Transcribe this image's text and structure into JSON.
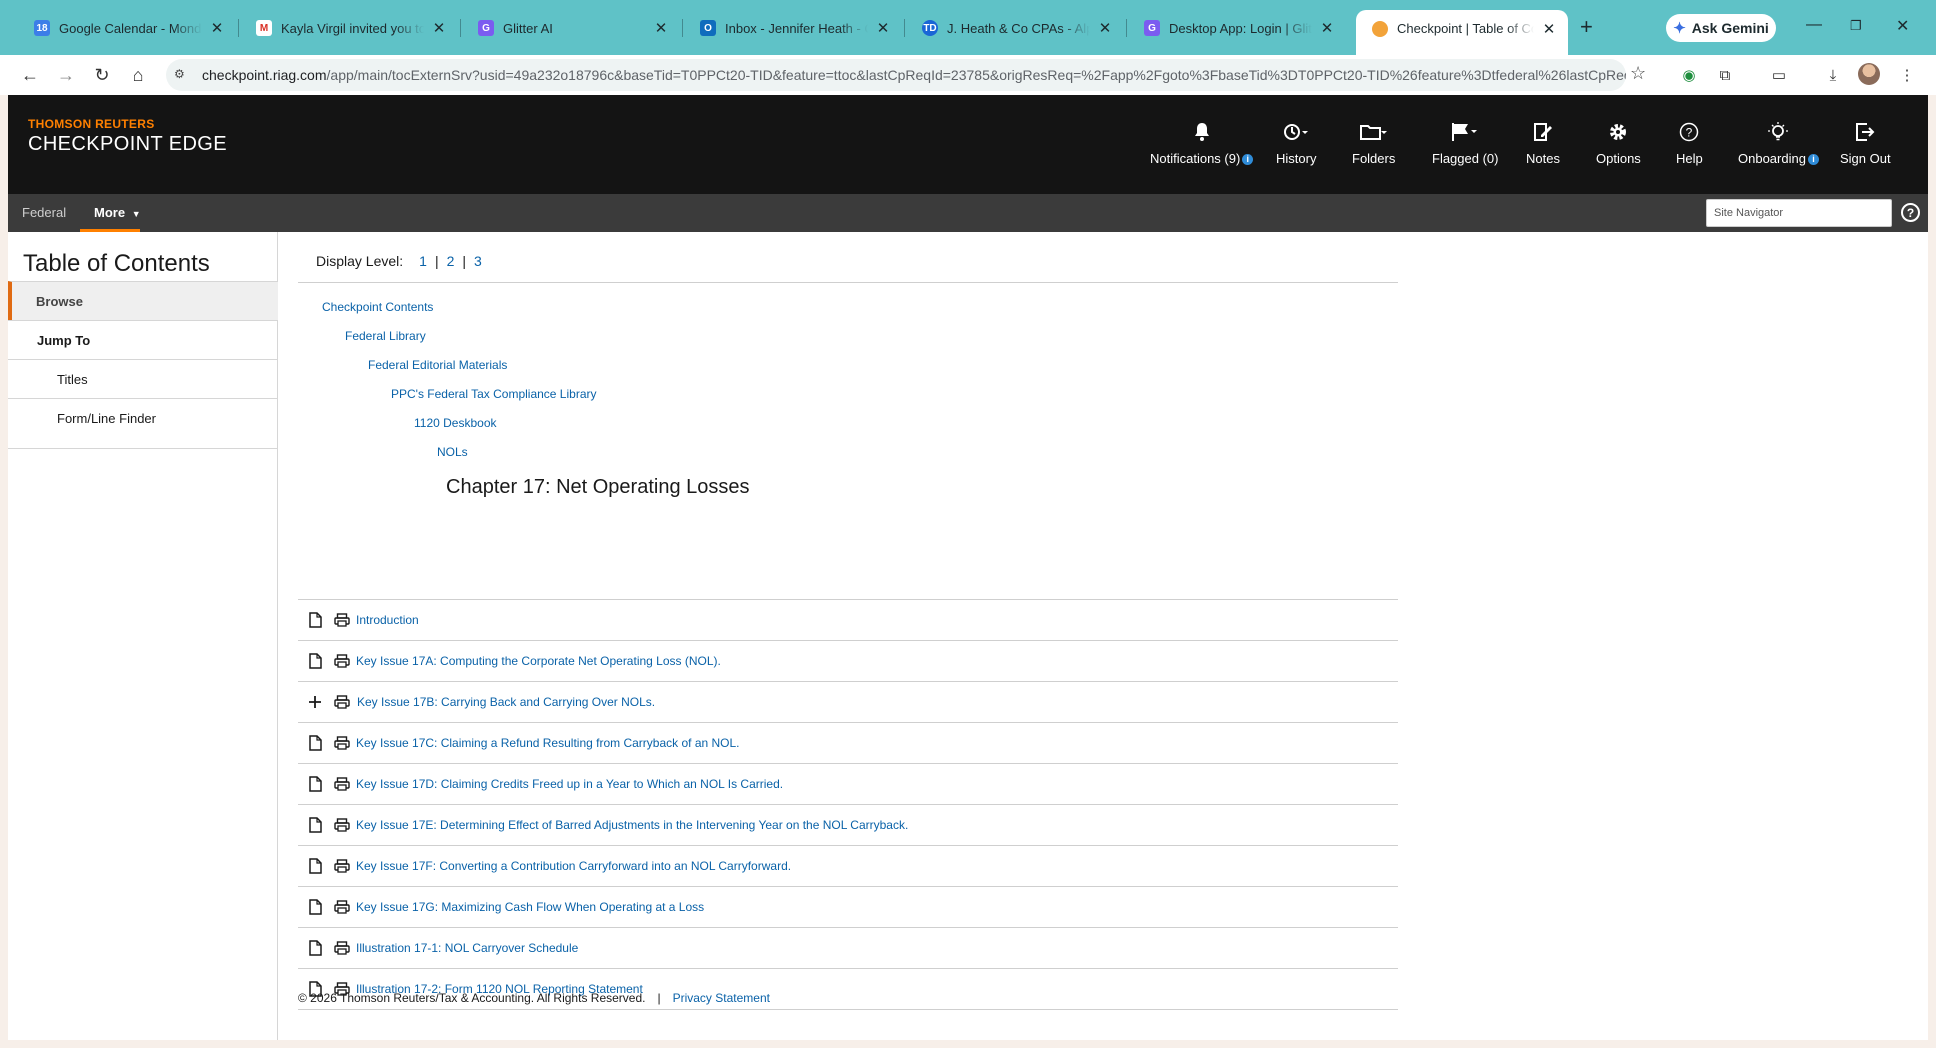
{
  "browser": {
    "tabs": [
      {
        "title": "Google Calendar - Monday,",
        "icon": "calendar-icon",
        "color": "#3c7ee8"
      },
      {
        "title": "Kayla Virgil invited you to jo",
        "icon": "gmail-icon",
        "color": "#d93025"
      },
      {
        "title": "Glitter AI",
        "icon": "glitter-icon",
        "color": "#7b5cf0"
      },
      {
        "title": "Inbox - Jennifer Heath - Out",
        "icon": "outlook-icon",
        "color": "#0f6cbd"
      },
      {
        "title": "J. Heath & Co CPAs - Alperin",
        "icon": "teamdrive-icon",
        "color": "#1a66d6"
      },
      {
        "title": "Desktop App: Login | Glitter",
        "icon": "glitter-icon",
        "color": "#7b5cf0"
      },
      {
        "title": "Checkpoint | Table of Conter",
        "icon": "checkpoint-icon",
        "color": "#f2a33a"
      }
    ],
    "new_tab": "+",
    "ask_gemini": "Ask Gemini",
    "url_host": "checkpoint.riag.com",
    "url_rest": "/app/main/tocExternSrv?usid=49a232o18796c&baseTid=T0PPCt20-TID&feature=ttoc&lastCpReqId=23785&origResReq=%2Fapp%2Fgoto%3FbaseTid%3DT0PPCt20-TID%26feature%3Dtfederal%26lastCpReql..."
  },
  "header": {
    "brand_top": "THOMSON REUTERS",
    "brand_main": "CHECKPOINT EDGE",
    "nav": [
      {
        "label": "Notifications (9)",
        "icon": "bell-icon",
        "badge": "i"
      },
      {
        "label": "History",
        "icon": "history-icon"
      },
      {
        "label": "Folders",
        "icon": "folder-icon"
      },
      {
        "label": "Flagged (0)",
        "icon": "flag-icon"
      },
      {
        "label": "Notes",
        "icon": "notes-icon"
      },
      {
        "label": "Options",
        "icon": "gear-icon"
      },
      {
        "label": "Help",
        "icon": "help-icon"
      },
      {
        "label": "Onboarding",
        "icon": "lightbulb-icon",
        "badge": "i"
      },
      {
        "label": "Sign Out",
        "icon": "sign-out-icon"
      }
    ]
  },
  "subnav": {
    "federal": "Federal",
    "more": "More",
    "site_navigator_placeholder": "Site Navigator",
    "help": "?"
  },
  "sidebar": {
    "title": "Table of Contents",
    "browse": "Browse",
    "jump_to": "Jump To",
    "titles": "Titles",
    "form_line_finder": "Form/Line Finder"
  },
  "content": {
    "display_level_label": "Display Level:",
    "levels": [
      "1",
      "2",
      "3"
    ],
    "breadcrumbs": [
      "Checkpoint Contents",
      "Federal Library",
      "Federal Editorial Materials",
      "PPC's Federal Tax Compliance Library",
      "1120 Deskbook",
      "NOLs"
    ],
    "chapter_title": "Chapter 17: Net Operating Losses",
    "items": [
      {
        "label": "Introduction",
        "expandable": false
      },
      {
        "label": "Key Issue 17A: Computing the Corporate Net Operating Loss (NOL).",
        "expandable": false
      },
      {
        "label": "Key Issue 17B: Carrying Back and Carrying Over NOLs.",
        "expandable": true
      },
      {
        "label": "Key Issue 17C: Claiming a Refund Resulting from Carryback of an NOL.",
        "expandable": false
      },
      {
        "label": "Key Issue 17D: Claiming Credits Freed up in a Year to Which an NOL Is Carried.",
        "expandable": false
      },
      {
        "label": "Key Issue 17E: Determining Effect of Barred Adjustments in the Intervening Year on the NOL Carryback.",
        "expandable": false
      },
      {
        "label": "Key Issue 17F: Converting a Contribution Carryforward into an NOL Carryforward.",
        "expandable": false
      },
      {
        "label": "Key Issue 17G: Maximizing Cash Flow When Operating at a Loss",
        "expandable": false
      },
      {
        "label": "Illustration 17-1: NOL Carryover Schedule",
        "expandable": false
      },
      {
        "label": "Illustration 17-2: Form 1120 NOL Reporting Statement",
        "expandable": false
      }
    ]
  },
  "footer": {
    "copyright": "© 2026 Thomson Reuters/Tax & Accounting. All Rights Reserved.",
    "separator": "|",
    "privacy": "Privacy Statement"
  },
  "colors": {
    "accent_orange": "#ff8000",
    "link_blue": "#0a62a8",
    "header_bg": "#141414",
    "chrome_teal": "#5fc2c7"
  }
}
